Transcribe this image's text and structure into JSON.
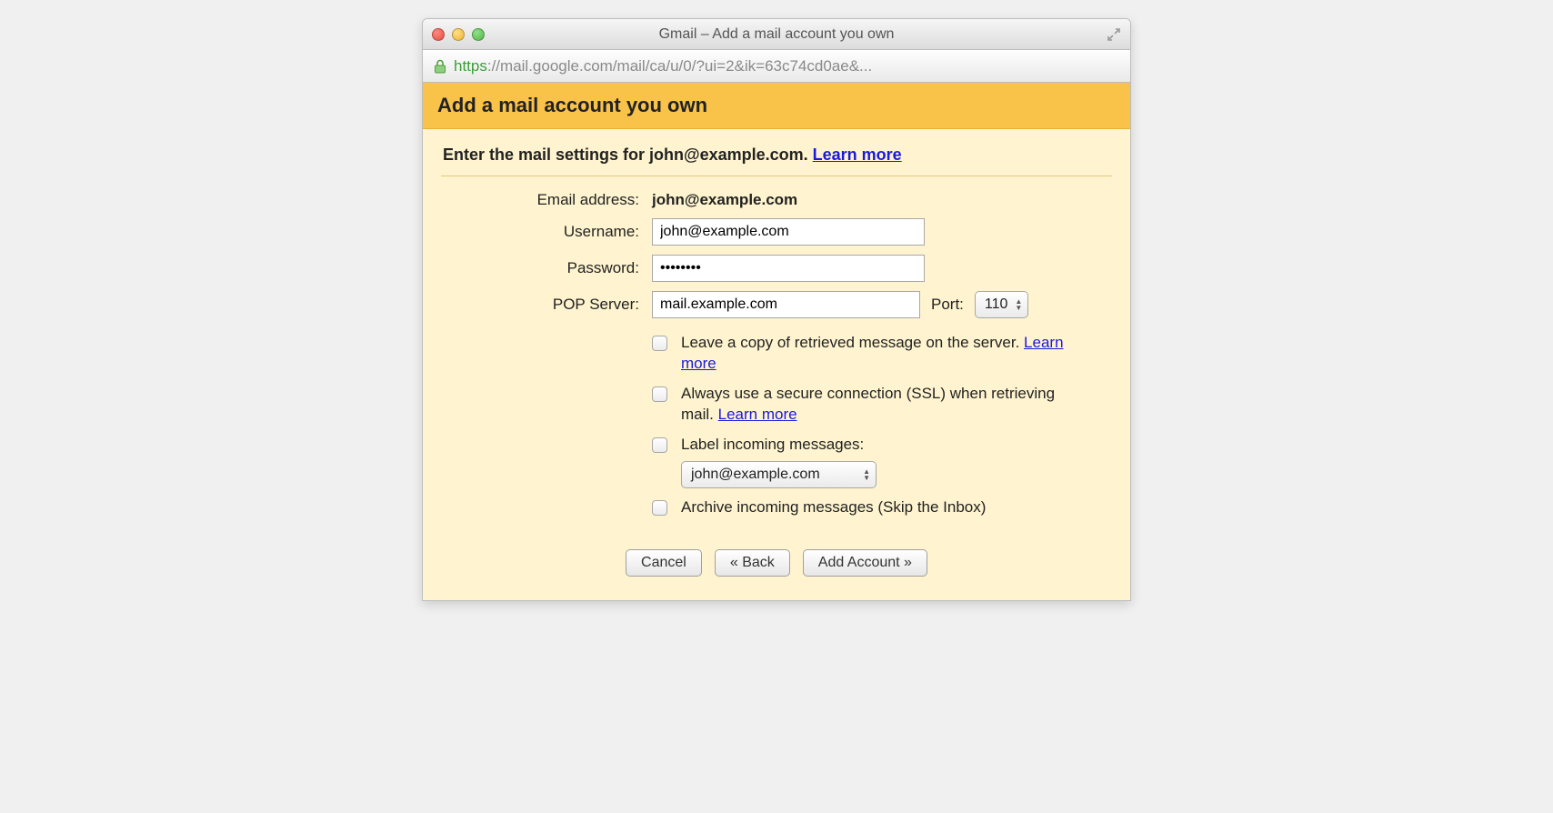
{
  "window": {
    "title": "Gmail – Add a mail account you own"
  },
  "addressbar": {
    "scheme": "https",
    "sep": "://",
    "host": "mail.google.com",
    "path": "/mail/ca/u/0/?ui=2&ik=63c74cd0ae&...",
    "lock_color": "#7ac142"
  },
  "header": {
    "title": "Add a mail account you own"
  },
  "instruction": {
    "prefix": "Enter the mail settings for ",
    "email": "john@example.com",
    "suffix": ". ",
    "learn_more": "Learn more"
  },
  "form": {
    "email_label": "Email address:",
    "email_value": "john@example.com",
    "username_label": "Username:",
    "username_value": "john@example.com",
    "password_label": "Password:",
    "password_value": "••••••••",
    "pop_label": "POP Server:",
    "pop_value": "mail.example.com",
    "port_label": "Port:",
    "port_value": "110"
  },
  "options": {
    "leave_copy": {
      "text": "Leave a copy of retrieved message on the server. ",
      "link": "Learn more"
    },
    "ssl": {
      "text": "Always use a secure connection (SSL) when retrieving mail. ",
      "link": "Learn more"
    },
    "label_incoming": {
      "text": "Label incoming messages:",
      "select_value": "john@example.com"
    },
    "archive": {
      "text": "Archive incoming messages (Skip the Inbox)"
    }
  },
  "buttons": {
    "cancel": "Cancel",
    "back": "« Back",
    "add": "Add Account »"
  }
}
